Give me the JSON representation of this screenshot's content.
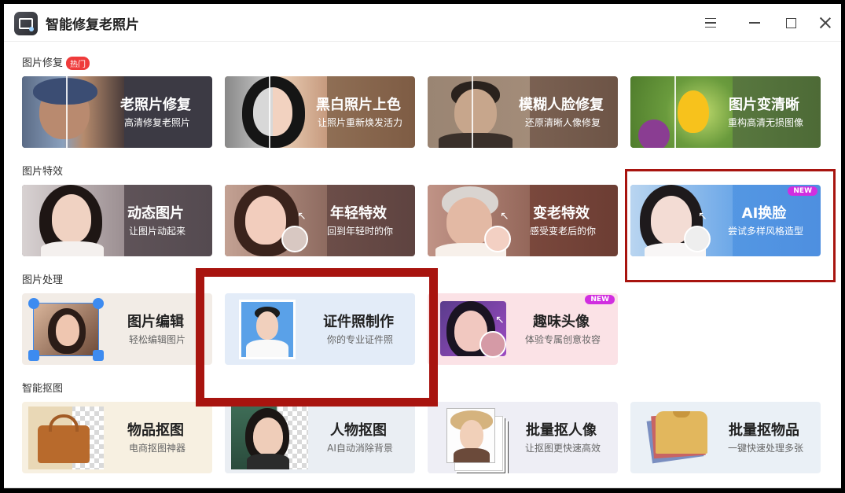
{
  "app": {
    "title": "智能修复老照片"
  },
  "sections": {
    "repair": {
      "title": "图片修复",
      "badge": "热门"
    },
    "effects": {
      "title": "图片特效"
    },
    "process": {
      "title": "图片处理"
    },
    "cutout": {
      "title": "智能抠图"
    }
  },
  "cards": {
    "old_photo": {
      "title": "老照片修复",
      "sub": "高清修复老照片"
    },
    "colorize": {
      "title": "黑白照片上色",
      "sub": "让照片重新焕发活力"
    },
    "blur_face": {
      "title": "模糊人脸修复",
      "sub": "还原清晰人像修复"
    },
    "sharpen": {
      "title": "图片变清晰",
      "sub": "重构高清无损图像"
    },
    "animate": {
      "title": "动态图片",
      "sub": "让图片动起来"
    },
    "younger": {
      "title": "年轻特效",
      "sub": "回到年轻时的你"
    },
    "older": {
      "title": "变老特效",
      "sub": "感受变老后的你"
    },
    "face_swap": {
      "title": "AI换脸",
      "sub": "尝试多样风格造型",
      "badge": "NEW"
    },
    "edit": {
      "title": "图片编辑",
      "sub": "轻松编辑图片"
    },
    "id_photo": {
      "title": "证件照制作",
      "sub": "你的专业证件照"
    },
    "avatar": {
      "title": "趣味头像",
      "sub": "体验专属创意妆容",
      "badge": "NEW"
    },
    "item_cutout": {
      "title": "物品抠图",
      "sub": "电商抠图神器"
    },
    "person_cutout": {
      "title": "人物抠图",
      "sub": "AI自动消除背景"
    },
    "batch_person": {
      "title": "批量抠人像",
      "sub": "让抠图更快速高效"
    },
    "batch_item": {
      "title": "批量抠物品",
      "sub": "一键快速处理多张"
    }
  },
  "colors": {
    "highlight": "#a8140f",
    "hot_badge": "#ef3b3b",
    "new_badge": "#d12ee0"
  }
}
